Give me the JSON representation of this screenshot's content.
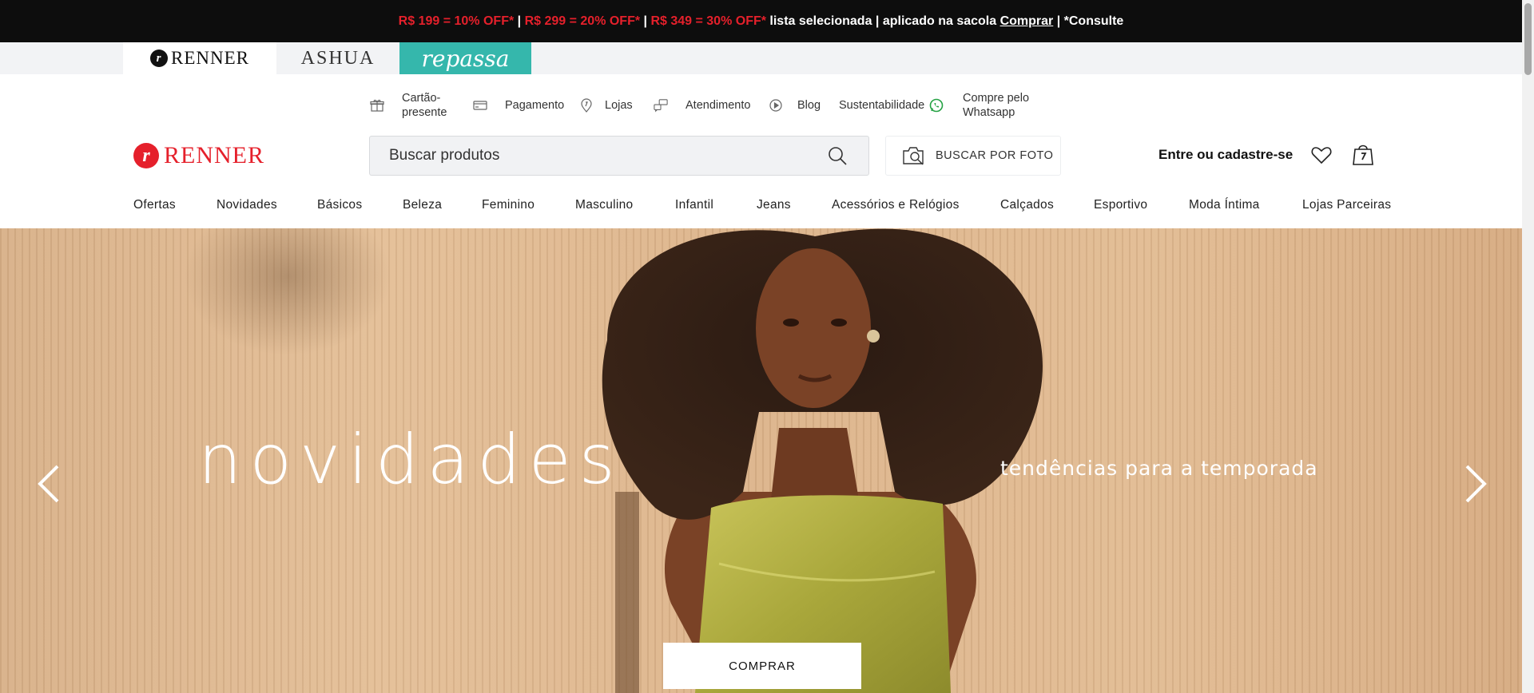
{
  "promo_bar": {
    "offer1": "R$ 199 = 10% OFF*",
    "sep1": " | ",
    "offer2": "R$ 299 = 20% OFF*",
    "sep2": " | ",
    "offer3": "R$ 349 = 30% OFF*",
    "text": " lista selecionada | aplicado na sacola ",
    "link": "Comprar",
    "suffix": " | *Consulte"
  },
  "brand_tabs": {
    "renner": "RENNER",
    "renner_mark": "r",
    "ashua": "ASHUA",
    "repassa": "repassa"
  },
  "utility_links": [
    {
      "label": "Cartão-\npresente",
      "icon": "gift-icon"
    },
    {
      "label": "Pagamento",
      "icon": "card-icon"
    },
    {
      "label": "Lojas",
      "icon": "location-pin-icon"
    },
    {
      "label": "Atendimento",
      "icon": "chat-bubbles-icon"
    },
    {
      "label": "Blog",
      "icon": "play-circle-icon"
    },
    {
      "label": "Sustentabilidade",
      "icon": ""
    },
    {
      "label": "Compre pelo\nWhatsapp",
      "icon": "whatsapp-icon"
    }
  ],
  "header": {
    "logo_mark": "r",
    "logo_text": "RENNER",
    "search_placeholder": "Buscar produtos",
    "photo_search_label": "BUSCAR POR FOTO",
    "login_label": "Entre ou cadastre-se"
  },
  "nav": [
    "Ofertas",
    "Novidades",
    "Básicos",
    "Beleza",
    "Feminino",
    "Masculino",
    "Infantil",
    "Jeans",
    "Acessórios e Relógios",
    "Calçados",
    "Esportivo",
    "Moda Íntima",
    "Lojas Parceiras"
  ],
  "hero": {
    "title": "novidades",
    "subtitle": "tendências para a temporada",
    "cta": "COMPRAR"
  },
  "colors": {
    "brand_red": "#e5202b",
    "promo_bg": "#0d0d0d",
    "repassa_teal": "#35b7ac",
    "whatsapp_green": "#25a244"
  }
}
